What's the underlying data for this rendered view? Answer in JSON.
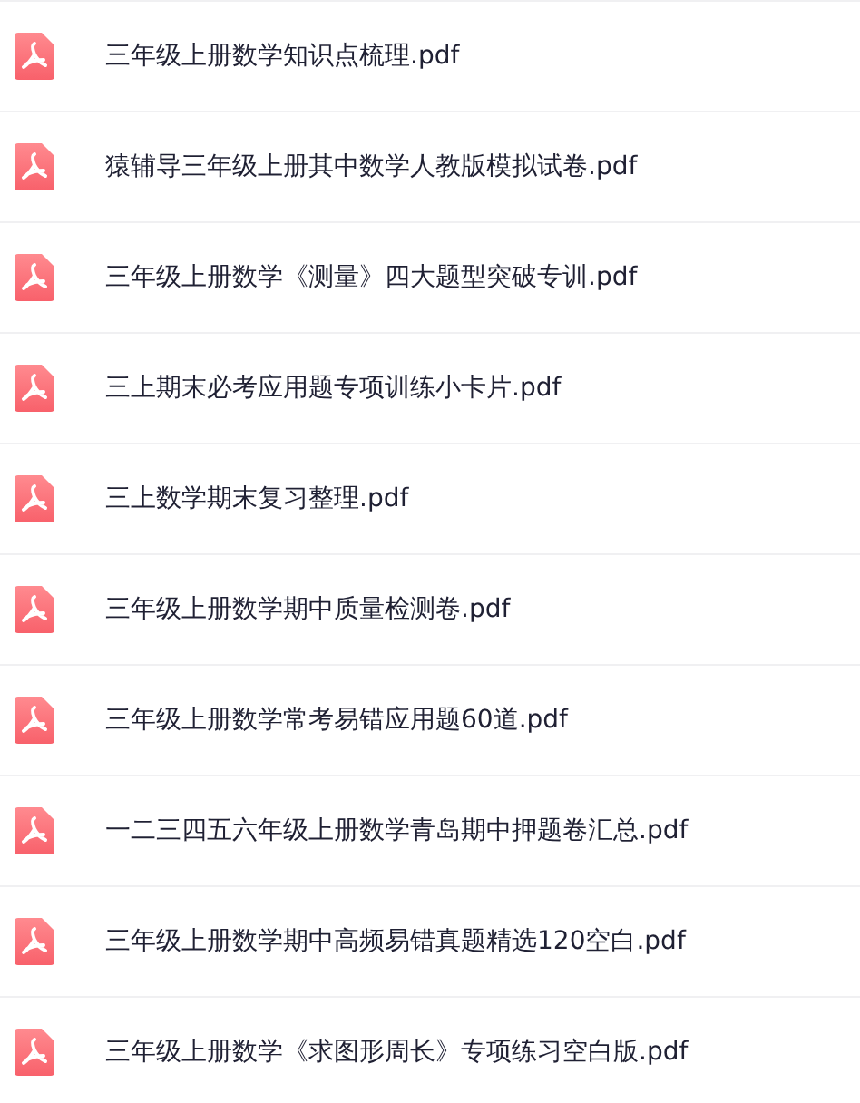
{
  "files": [
    {
      "name": "三年级上册数学知识点梳理.pdf"
    },
    {
      "name": "猿辅导三年级上册其中数学人教版模拟试卷.pdf"
    },
    {
      "name": "三年级上册数学《测量》四大题型突破专训.pdf"
    },
    {
      "name": "三上期末必考应用题专项训练小卡片.pdf"
    },
    {
      "name": "三上数学期末复习整理.pdf"
    },
    {
      "name": "三年级上册数学期中质量检测卷.pdf"
    },
    {
      "name": "三年级上册数学常考易错应用题60道.pdf"
    },
    {
      "name": "一二三四五六年级上册数学青岛期中押题卷汇总.pdf"
    },
    {
      "name": "三年级上册数学期中高频易错真题精选120空白.pdf"
    },
    {
      "name": "三年级上册数学《求图形周长》专项练习空白版.pdf"
    }
  ]
}
